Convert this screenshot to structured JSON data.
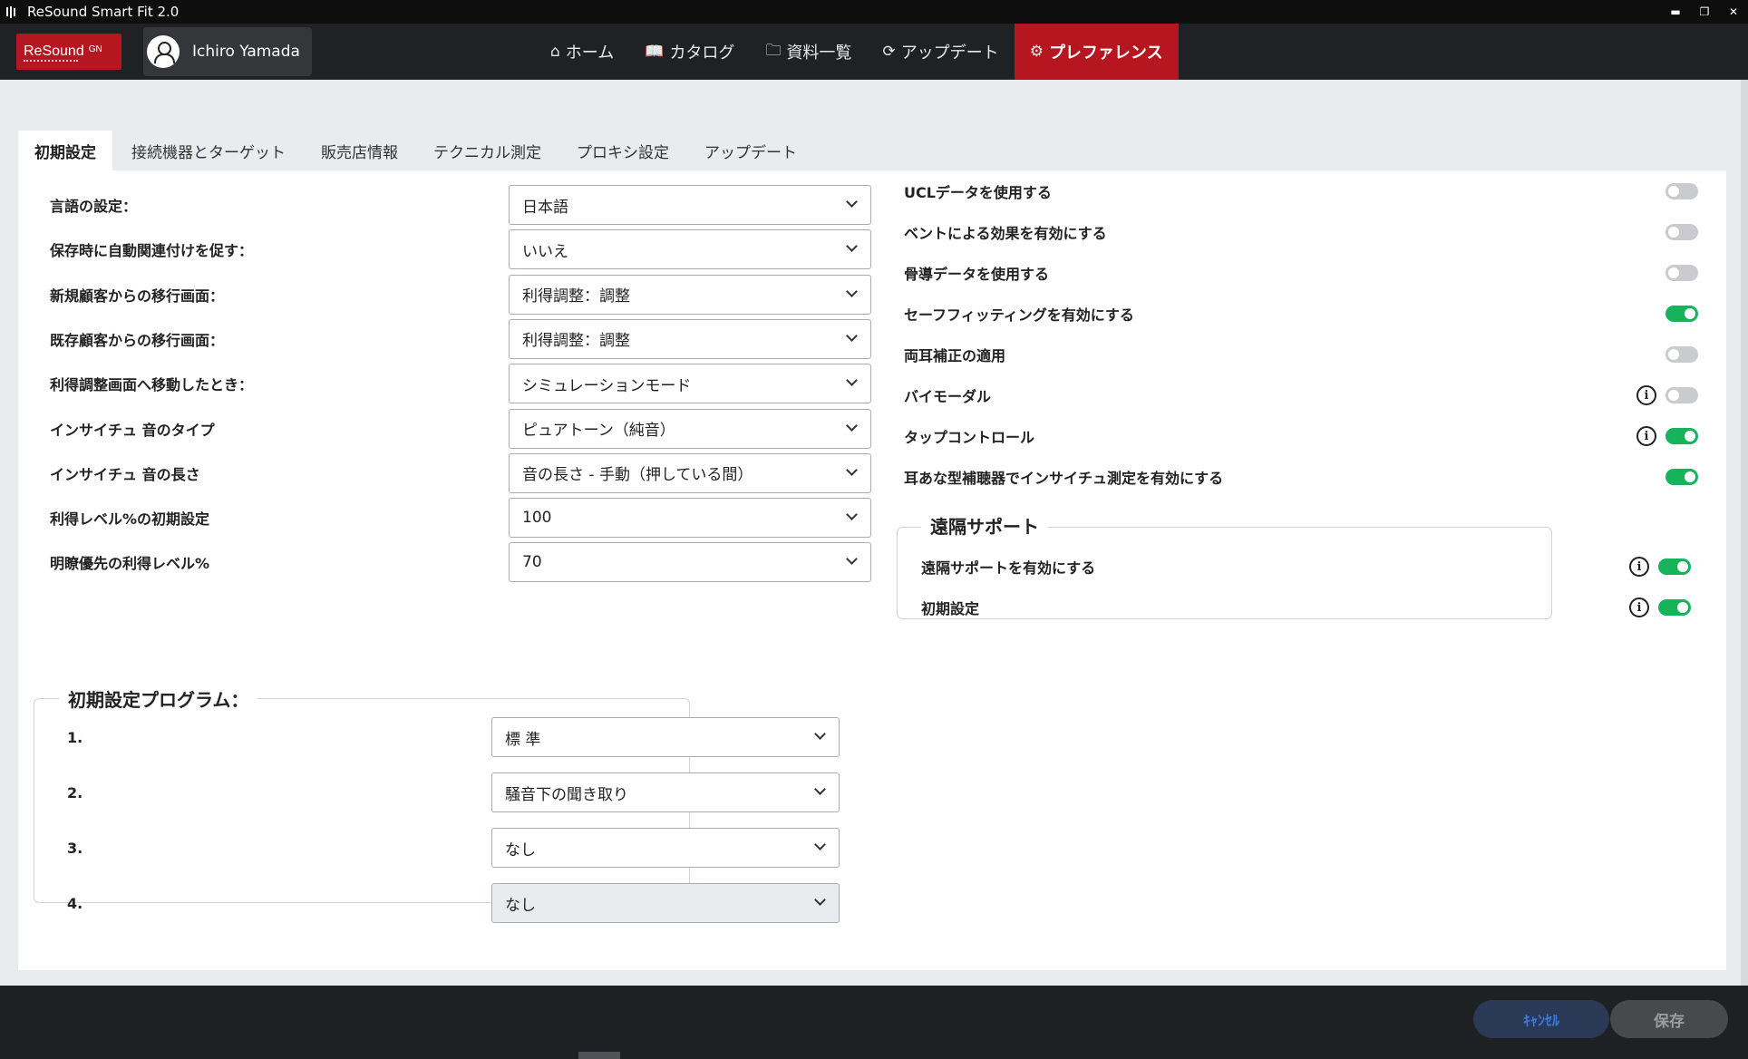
{
  "window": {
    "title": "ReSound Smart Fit 2.0",
    "minimize": "▬",
    "maximize": "❐",
    "close": "✕"
  },
  "header": {
    "logo_text": "ReSound",
    "logo_sup": "GN",
    "user_name": "Ichiro Yamada",
    "nav": [
      {
        "label": "ホーム",
        "icon": "home-icon",
        "glyph": "⌂"
      },
      {
        "label": "カタログ",
        "icon": "book-icon",
        "glyph": "📖"
      },
      {
        "label": "資料一覧",
        "icon": "folder-icon",
        "glyph": "🗀"
      },
      {
        "label": "アップデート",
        "icon": "refresh-icon",
        "glyph": "⟳"
      },
      {
        "label": "プレファレンス",
        "icon": "gear-icon",
        "glyph": "⚙",
        "active": true
      }
    ]
  },
  "tabs": [
    "初期設定",
    "接続機器とターゲット",
    "販売店情報",
    "テクニカル測定",
    "プロキシ設定",
    "アップデート"
  ],
  "left_settings": [
    {
      "label": "言語の設定：",
      "value": "日本語"
    },
    {
      "label": "保存時に自動関連付けを促す：",
      "value": "いいえ"
    },
    {
      "label": "新規顧客からの移行画面：",
      "value": "利得調整：調整"
    },
    {
      "label": "既存顧客からの移行画面：",
      "value": "利得調整：調整"
    },
    {
      "label": "利得調整画面へ移動したとき：",
      "value": "シミュレーションモード"
    },
    {
      "label": "インサイチュ 音のタイプ",
      "value": "ピュアトーン（純音）"
    },
    {
      "label": "インサイチュ 音の長さ",
      "value": "音の長さ - 手動（押している間）"
    },
    {
      "label": "利得レベル%の初期設定",
      "value": "100"
    },
    {
      "label": "明瞭優先の利得レベル%",
      "value": "70"
    }
  ],
  "programs": {
    "legend": "初期設定プログラム：",
    "items": [
      {
        "num": "1.",
        "value": "標 準"
      },
      {
        "num": "2.",
        "value": "騒音下の聞き取り"
      },
      {
        "num": "3.",
        "value": "なし"
      },
      {
        "num": "4.",
        "value": "なし",
        "disabled": true
      }
    ]
  },
  "right_settings": [
    {
      "label": "UCLデータを使用する",
      "on": false,
      "info": false
    },
    {
      "label": "ベントによる効果を有効にする",
      "on": false,
      "info": false
    },
    {
      "label": "骨導データを使用する",
      "on": false,
      "info": false
    },
    {
      "label": "セーフフィッティングを有効にする",
      "on": true,
      "info": false
    },
    {
      "label": "両耳補正の適用",
      "on": false,
      "info": false
    },
    {
      "label": "バイモーダル",
      "on": false,
      "info": true
    },
    {
      "label": "タップコントロール",
      "on": true,
      "info": true
    },
    {
      "label": "耳あな型補聴器でインサイチュ測定を有効にする",
      "on": true,
      "info": false
    }
  ],
  "remote": {
    "legend": "遠隔サポート",
    "items": [
      {
        "label": "遠隔サポートを有効にする",
        "on": true,
        "info": true
      },
      {
        "label": "初期設定",
        "on": true,
        "info": true
      }
    ]
  },
  "footer": {
    "cancel": "ｷｬﾝｾﾙ",
    "save": "保存"
  },
  "info_glyph": "i",
  "colors": {
    "brand_red": "#b5161f",
    "toggle_on": "#17b35a",
    "toggle_off": "#c9cbce"
  }
}
